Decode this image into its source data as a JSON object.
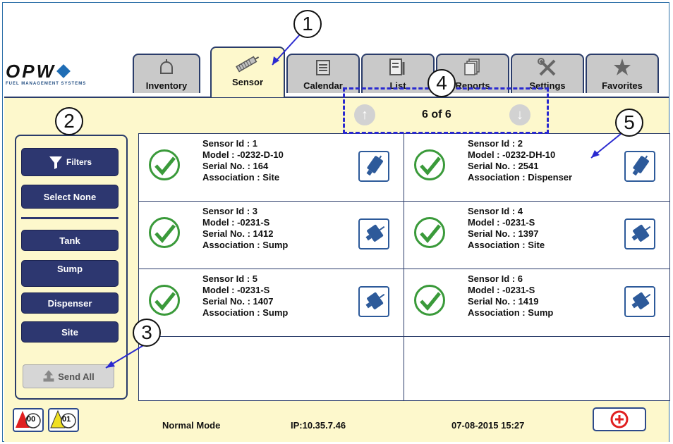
{
  "logo": {
    "main": "OPW",
    "sub": "FUEL MANAGEMENT SYSTEMS"
  },
  "tabs": [
    {
      "label": "Inventory",
      "icon": "tank-icon"
    },
    {
      "label": "Sensor",
      "icon": "probe-icon"
    },
    {
      "label": "Calendar",
      "icon": "calendar-icon"
    },
    {
      "label": "List",
      "icon": "list-icon"
    },
    {
      "label": "Reports",
      "icon": "reports-icon"
    },
    {
      "label": "Settings",
      "icon": "tools-icon"
    },
    {
      "label": "Favorites",
      "icon": "star-icon"
    }
  ],
  "active_tab": "Sensor",
  "sidebar": {
    "filters_label": "Filters",
    "select_none_label": "Select None",
    "items": [
      {
        "label": "Tank"
      },
      {
        "label": "Sump"
      },
      {
        "label": "Dispenser"
      },
      {
        "label": "Site"
      }
    ],
    "send_all_label": "Send All"
  },
  "pager": {
    "text": "6 of 6",
    "up": "↑",
    "down": "↓"
  },
  "sensors": [
    {
      "id": "Sensor Id : 1",
      "model": "Model : -0232-D-10",
      "serial": "Serial No. : 164",
      "association": "Association : Site"
    },
    {
      "id": "Sensor Id : 2",
      "model": "Model : -0232-DH-10",
      "serial": "Serial No. : 2541",
      "association": "Association : Dispenser"
    },
    {
      "id": "Sensor Id : 3",
      "model": "Model : -0231-S",
      "serial": "Serial No. : 1412",
      "association": "Association : Sump"
    },
    {
      "id": "Sensor Id : 4",
      "model": "Model : -0231-S",
      "serial": "Serial No. : 1397",
      "association": "Association : Site"
    },
    {
      "id": "Sensor Id : 5",
      "model": "Model : -0231-S",
      "serial": "Serial No. : 1407",
      "association": "Association : Sump"
    },
    {
      "id": "Sensor Id : 6",
      "model": "Model : -0231-S",
      "serial": "Serial No. : 1419",
      "association": "Association : Sump"
    }
  ],
  "status": {
    "alarm_count": "00",
    "warning_count": "01",
    "mode": "Normal Mode",
    "ip": "IP:10.35.7.46",
    "datetime": "07-08-2015 15:27"
  },
  "callouts": [
    "1",
    "2",
    "3",
    "4",
    "5"
  ],
  "colors": {
    "accent": "#2d3770",
    "background": "#fdf8cc",
    "ok": "#3a9a3a",
    "alarm": "#e02020",
    "warning": "#f0e020",
    "callout_line": "#2a2ad0"
  }
}
